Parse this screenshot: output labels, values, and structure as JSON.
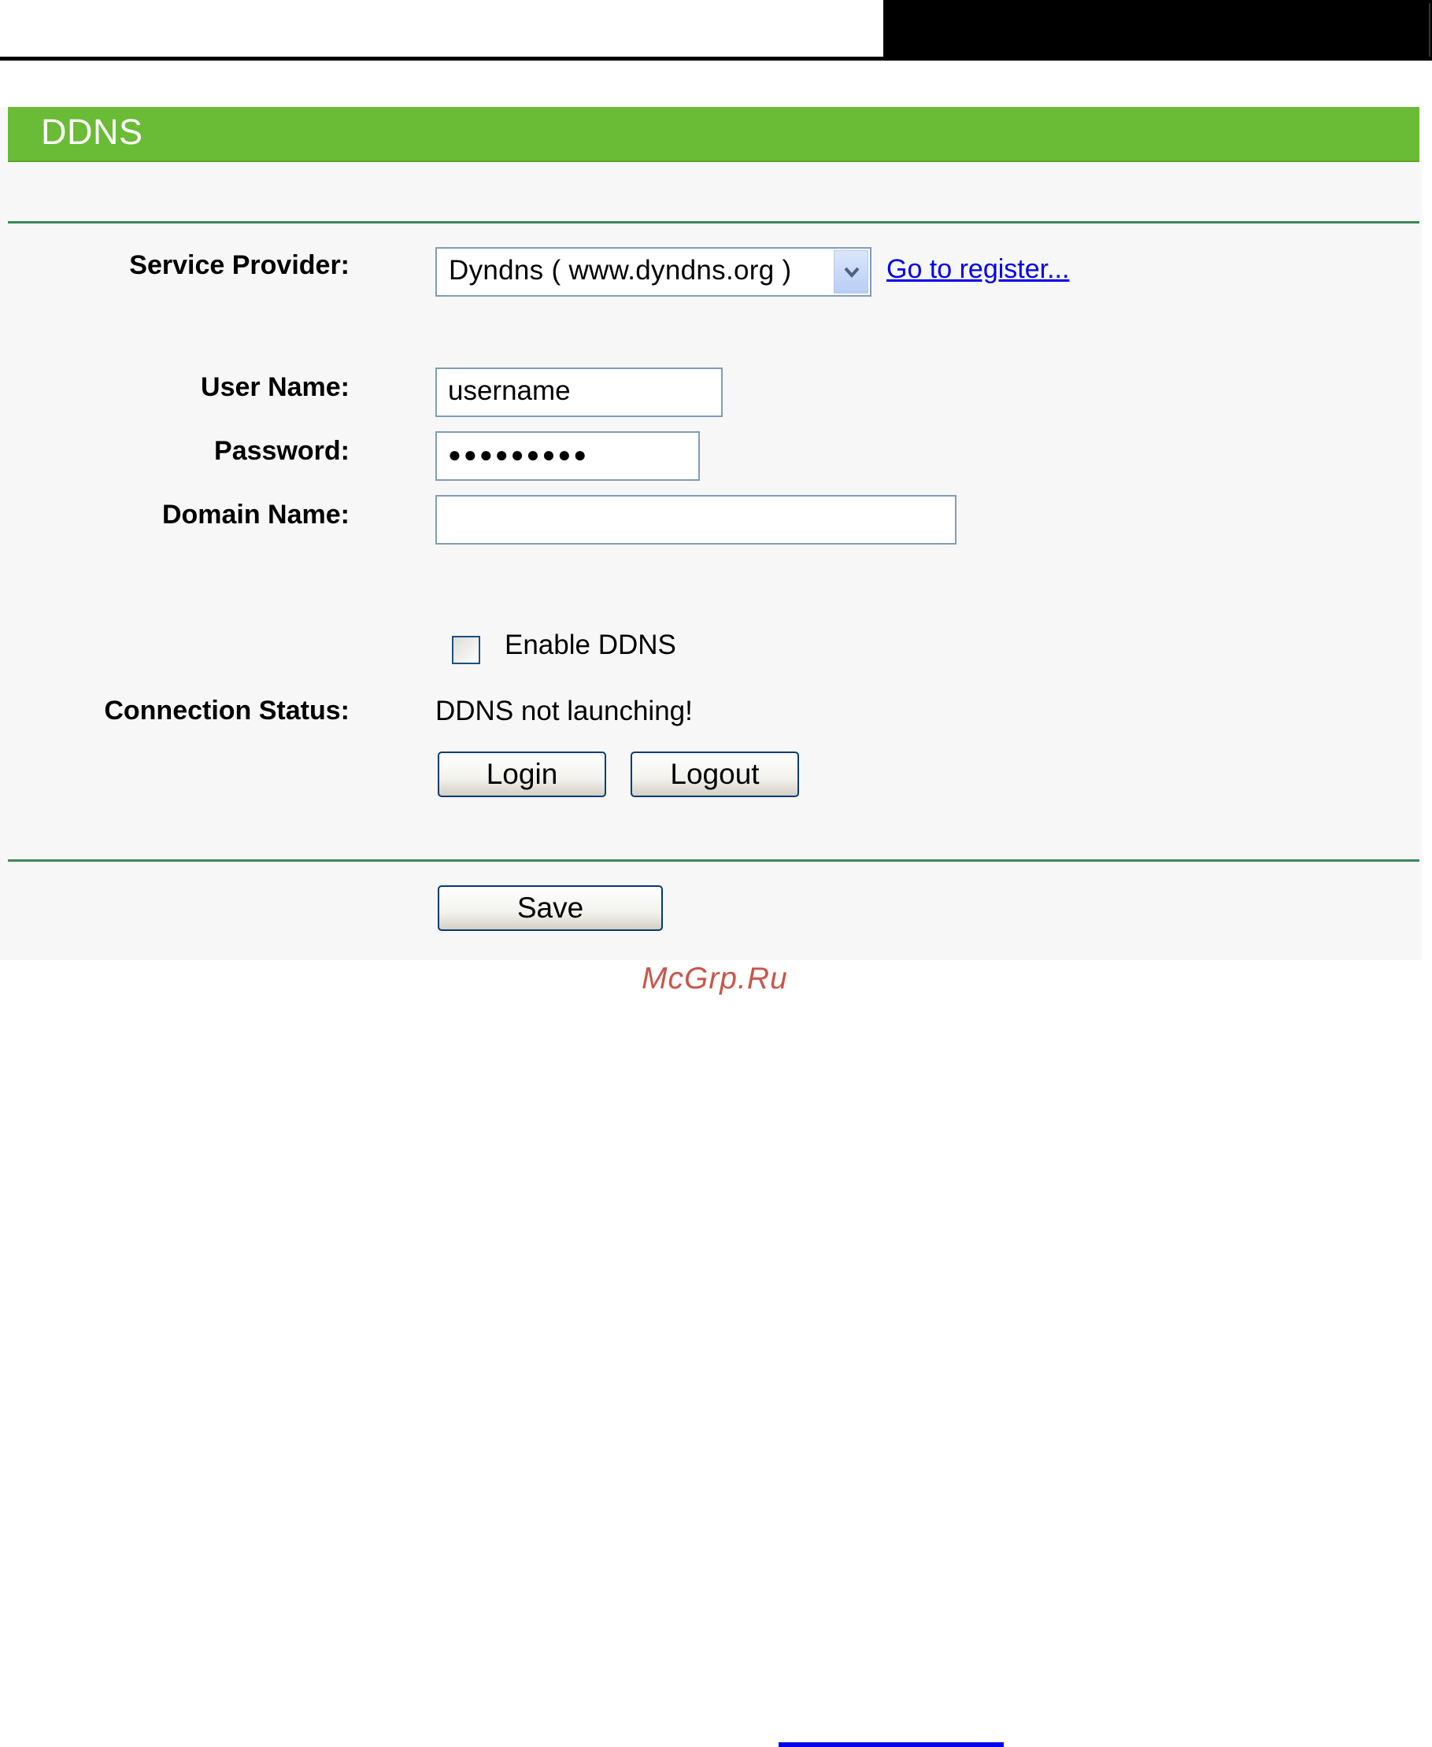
{
  "panel": {
    "title": "DDNS"
  },
  "form": {
    "service_provider": {
      "label": "Service Provider:",
      "selected": "Dyndns ( www.dyndns.org )",
      "register_link": "Go to register..."
    },
    "user_name": {
      "label": "User Name:",
      "value": "username"
    },
    "password": {
      "label": "Password:",
      "value": "●●●●●●●●●"
    },
    "domain_name": {
      "label": "Domain Name:",
      "value": ""
    },
    "enable_ddns": {
      "label": "Enable DDNS",
      "checked": false
    },
    "connection_status": {
      "label": "Connection Status:",
      "value": "DDNS not launching!"
    },
    "login_label": "Login",
    "logout_label": "Logout",
    "save_label": "Save"
  },
  "watermark": "McGrp.Ru",
  "colors": {
    "title_bar": "#6abb35",
    "rule": "#3a8a57",
    "panel_bg": "#f7f7f7",
    "link": "#0000ee"
  }
}
